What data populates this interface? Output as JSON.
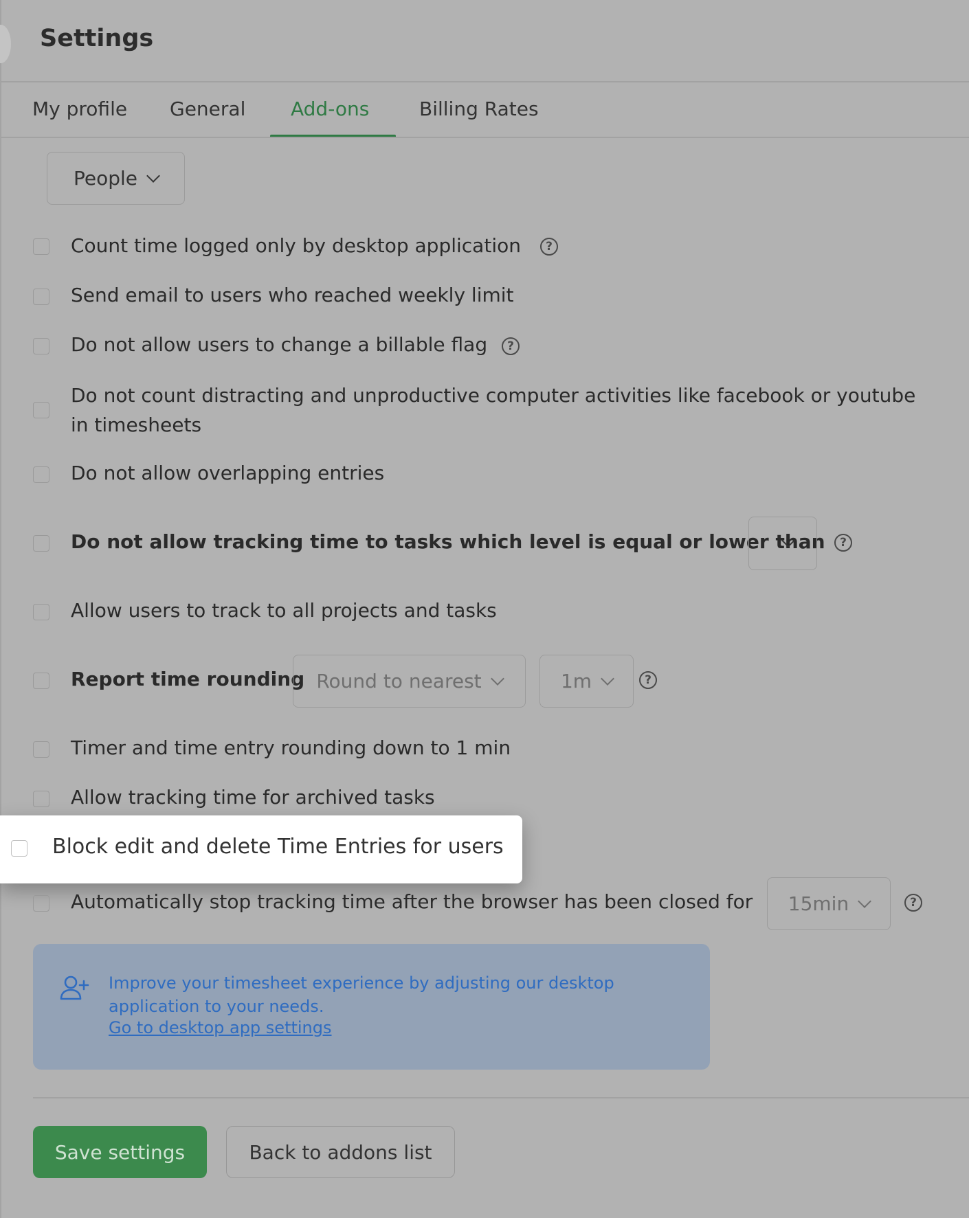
{
  "header": {
    "title": "Settings"
  },
  "tabs": [
    {
      "label": "My profile",
      "active": false
    },
    {
      "label": "General",
      "active": false
    },
    {
      "label": "Add-ons",
      "active": true
    },
    {
      "label": "Billing Rates",
      "active": false
    }
  ],
  "filter": {
    "selected": "People"
  },
  "settings": [
    {
      "label": "Count time logged only by desktop application",
      "checked": false,
      "help": true
    },
    {
      "label": "Send email to users who reached weekly limit",
      "checked": false
    },
    {
      "label": "Do not allow users to change a billable flag",
      "checked": false,
      "help": true
    },
    {
      "label": "Do not count distracting and unproductive computer activities like facebook or youtube in timesheets",
      "checked": false
    },
    {
      "label": "Do not allow overlapping entries",
      "checked": false
    },
    {
      "label": "Do not allow tracking time to tasks which level is equal or lower than",
      "checked": false,
      "level_value": "",
      "help": true
    },
    {
      "label": "Allow users to track to all projects and tasks",
      "checked": false
    },
    {
      "label": "Report time rounding",
      "checked": false,
      "mode": "Round to nearest",
      "interval": "1m",
      "help": true
    },
    {
      "label": "Timer and time entry rounding down to 1 min",
      "checked": false
    },
    {
      "label": "Allow tracking time for archived tasks",
      "checked": false
    },
    {
      "label": "Block edit and delete Time Entries for users",
      "checked": false,
      "highlighted": true
    },
    {
      "label": "Automatically stop tracking time after the browser has been closed for",
      "checked": false,
      "duration": "15min",
      "help": true
    }
  ],
  "info": {
    "icon": "add-user-icon",
    "text": "Improve your timesheet experience by adjusting our desktop application to your needs.",
    "link": "Go to desktop app settings"
  },
  "actions": {
    "save": "Save settings",
    "back": "Back to addons list"
  },
  "colors": {
    "accent": "#3c8a4d",
    "link": "#2f6cc0",
    "overlay_bg": "#b2b2b2"
  }
}
